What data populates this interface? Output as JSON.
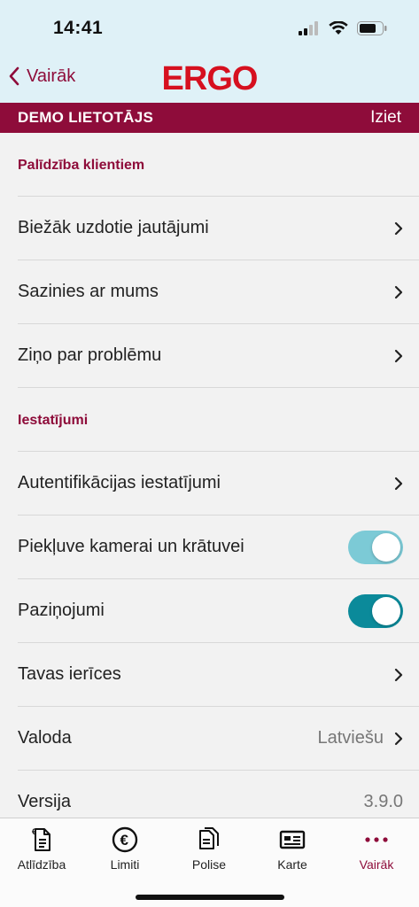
{
  "status_bar": {
    "time": "14:41"
  },
  "nav": {
    "back_label": "Vairāk",
    "logo": "ERGO"
  },
  "user_bar": {
    "name": "DEMO LIETOTĀJS",
    "logout": "Iziet"
  },
  "sections": [
    {
      "title": "Palīdzība klientiem",
      "rows": [
        {
          "label": "Biežāk uzdotie jautājumi",
          "type": "link"
        },
        {
          "label": "Sazinies ar mums",
          "type": "link"
        },
        {
          "label": "Ziņo par problēmu",
          "type": "link"
        }
      ]
    },
    {
      "title": "Iestatījumi",
      "rows": [
        {
          "label": "Autentifikācijas iestatījumi",
          "type": "link"
        },
        {
          "label": "Piekļuve kamerai un krātuvei",
          "type": "toggle",
          "on": true
        },
        {
          "label": "Paziņojumi",
          "type": "toggle",
          "on": true
        },
        {
          "label": "Tavas ierīces",
          "type": "link"
        },
        {
          "label": "Valoda",
          "type": "link",
          "value": "Latviešu"
        },
        {
          "label": "Versija",
          "type": "value",
          "value": "3.9.0"
        }
      ]
    }
  ],
  "tabs": [
    {
      "label": "Atlīdzība",
      "icon": "claim-document-icon"
    },
    {
      "label": "Limiti",
      "icon": "euro-circle-icon"
    },
    {
      "label": "Polise",
      "icon": "policy-document-icon"
    },
    {
      "label": "Karte",
      "icon": "card-icon"
    },
    {
      "label": "Vairāk",
      "icon": "more-dots-icon",
      "active": true
    }
  ],
  "colors": {
    "brand": "#8e0c3a",
    "logo_red": "#d6101f",
    "header_bg": "#dff1f7",
    "toggle_light": "#7ccad6",
    "toggle_dark": "#0b8a9a"
  }
}
